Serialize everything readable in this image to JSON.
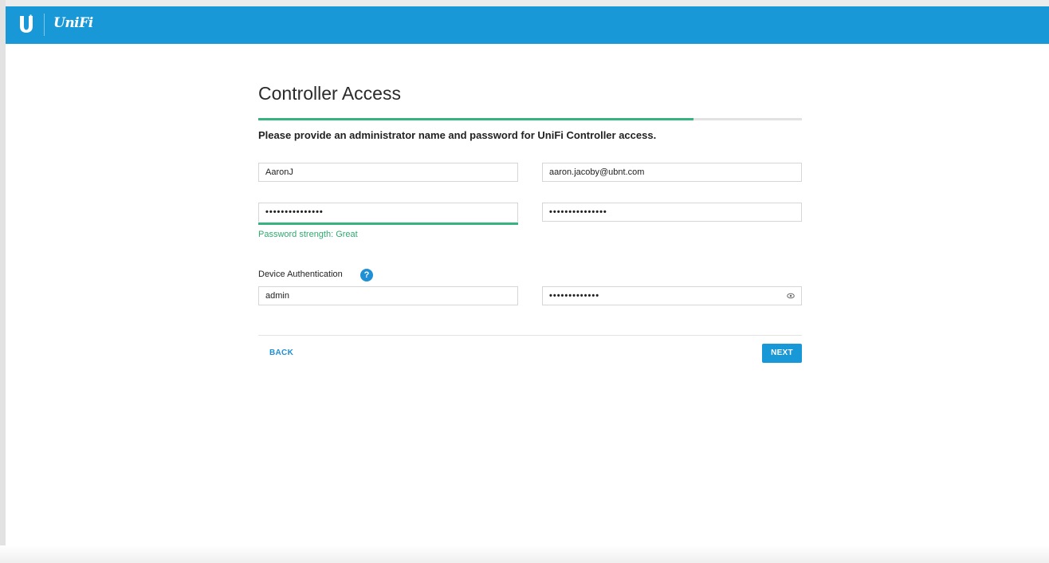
{
  "header": {
    "brand": "UniFi",
    "logo_icon": "ubiquiti-u-logo-icon",
    "color": "#1998d8"
  },
  "page": {
    "title": "Controller Access",
    "progress": 0.8,
    "subtitle": "Please provide an administrator name and password for UniFi Controller access."
  },
  "form": {
    "admin_name": "AaronJ",
    "email": "aaron.jacoby@ubnt.com",
    "password": "•••••••••••••••",
    "confirm_password": "•••••••••••••••",
    "password_strength": "Password strength: Great",
    "strength_color": "#36b37e",
    "device_auth_label": "Device Authentication",
    "help_icon": "?",
    "device_username": "admin",
    "device_password": "•••••••••••••"
  },
  "actions": {
    "back": "BACK",
    "next": "NEXT"
  }
}
